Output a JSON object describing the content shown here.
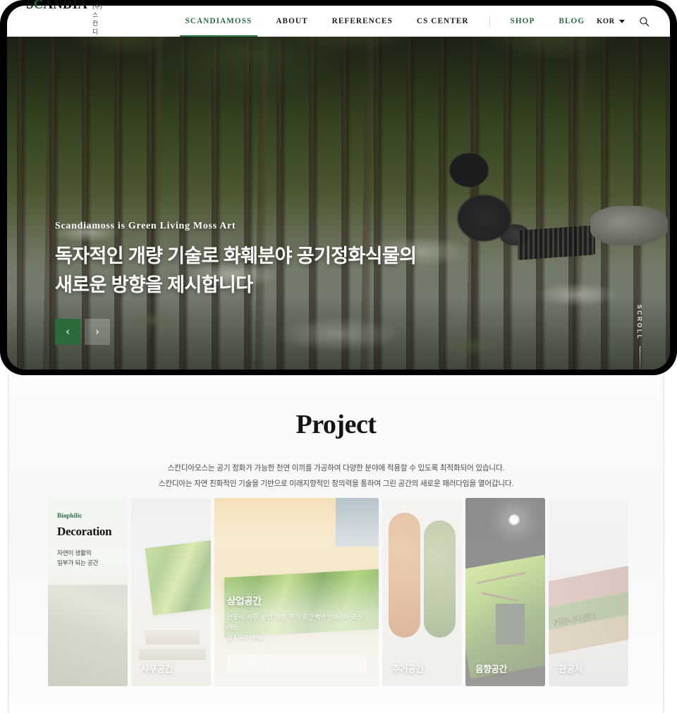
{
  "nav": {
    "brand": {
      "word_left": "S",
      "word_c": "C",
      "word_right": "ANDIA",
      "sub": "(주)스칸디아"
    },
    "items": [
      {
        "label": "SCANDIAMOSS",
        "state": "active"
      },
      {
        "label": "ABOUT",
        "state": "default"
      },
      {
        "label": "REFERENCES",
        "state": "default"
      },
      {
        "label": "CS CENTER",
        "state": "default"
      },
      {
        "label": "SHOP",
        "state": "green"
      },
      {
        "label": "BLOG",
        "state": "green"
      }
    ],
    "language": "KOR",
    "search_icon": "search-icon",
    "caret_icon": "chevron-down-icon"
  },
  "hero": {
    "eyebrow": "Scandiamoss is Green Living Moss Art",
    "headline_line1": "독자적인 개량 기술로 화훼분야 공기정화식물의",
    "headline_line2": "새로운 방향을 제시합니다",
    "prev_label": "‹",
    "next_label": "›",
    "scroll_label": "SCROLL",
    "accent_color": "#2b6b3b"
  },
  "project": {
    "title": "Project",
    "desc_line1": "스칸디아모스는 공기 정화가 가능한 천연 이끼를 가공하여 다양한 분야에 적용할 수 있도록 최적화되어 있습니다.",
    "desc_line2": "스칸디아는 자연 친화적인 기술을 기반으로 미래지향적인 창의력을 통하여 그린 공간의 새로운 패러다임을 열어갑니다.",
    "cards": [
      {
        "kind": "decoration",
        "eyebrow": "Biophilic",
        "title": "Decoration",
        "sub_line1": "자연이 생활의",
        "sub_line2": "일부가 되는 공간"
      },
      {
        "kind": "office",
        "label": "사무공간"
      },
      {
        "kind": "commercial",
        "title": "상업공간",
        "desc_line1": "관공서, 사무, 상업, 음향, 주거 공간 벽면 인테리어 모스 아트",
        "desc_line2": "월 디자인 패널",
        "button_label": "자세히 보기",
        "button_arrow": "›"
      },
      {
        "kind": "residential",
        "label": "주거공간"
      },
      {
        "kind": "acoustic",
        "label": "음향공간"
      },
      {
        "kind": "public",
        "label": "관공서",
        "wall_text": "커뮤니티센터"
      }
    ]
  }
}
